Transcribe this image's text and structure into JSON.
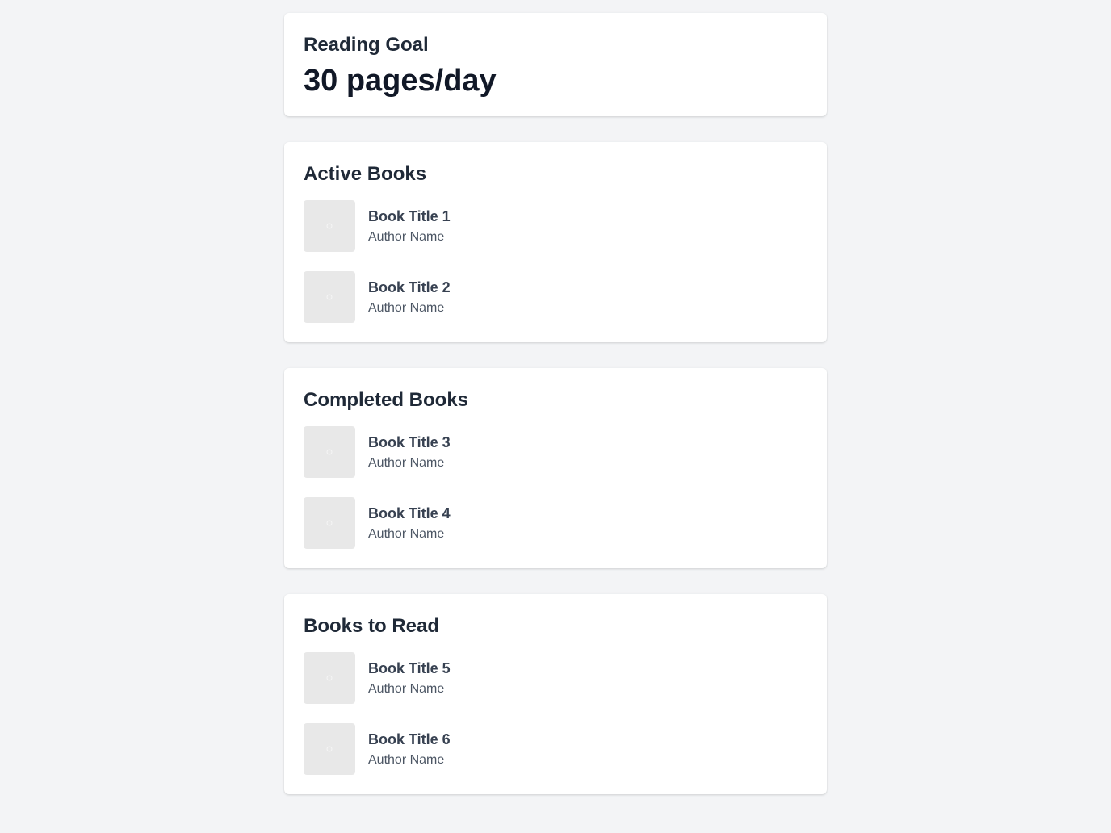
{
  "goal": {
    "label": "Reading Goal",
    "value": "30 pages/day"
  },
  "sections": [
    {
      "title": "Active Books",
      "books": [
        {
          "title": "Book Title 1",
          "author": "Author Name"
        },
        {
          "title": "Book Title 2",
          "author": "Author Name"
        }
      ]
    },
    {
      "title": "Completed Books",
      "books": [
        {
          "title": "Book Title 3",
          "author": "Author Name"
        },
        {
          "title": "Book Title 4",
          "author": "Author Name"
        }
      ]
    },
    {
      "title": "Books to Read",
      "books": [
        {
          "title": "Book Title 5",
          "author": "Author Name"
        },
        {
          "title": "Book Title 6",
          "author": "Author Name"
        }
      ]
    }
  ],
  "icons": {
    "cover": "image-placeholder-icon"
  },
  "colors": {
    "background": "#f3f4f6",
    "card": "#ffffff",
    "cover_placeholder": "#e8e8e8"
  }
}
